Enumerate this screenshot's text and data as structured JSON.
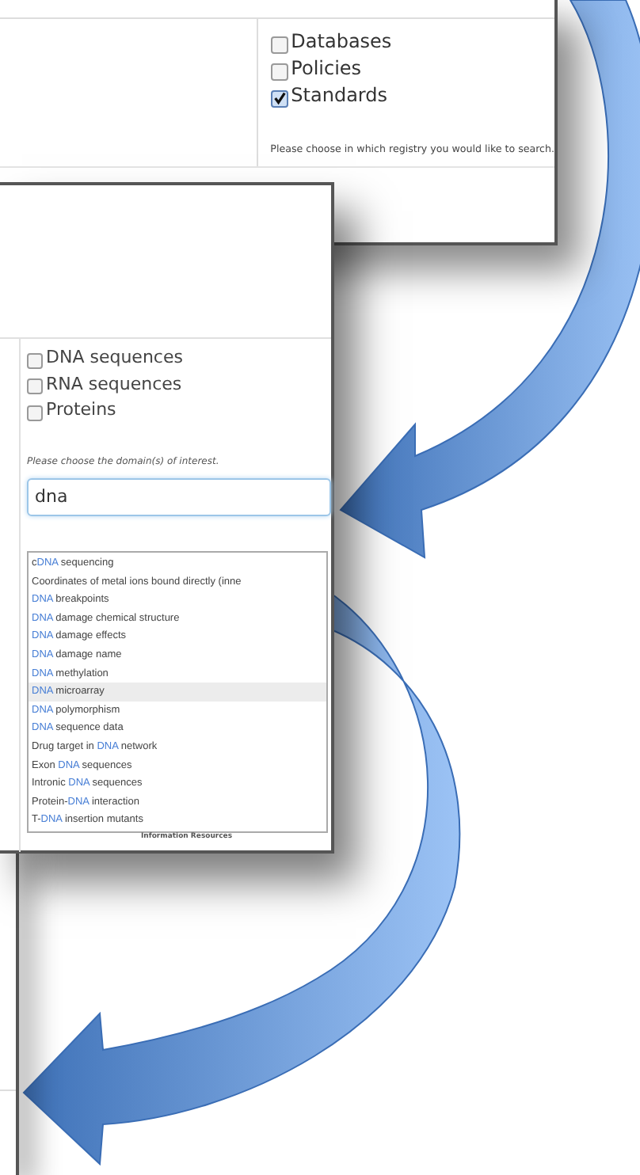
{
  "registry_panel": {
    "options": [
      {
        "label": "Databases",
        "checked": false
      },
      {
        "label": "Policies",
        "checked": false
      },
      {
        "label": "Standards",
        "checked": true
      }
    ],
    "help": "Please choose in which registry you would like to search."
  },
  "domain_panel": {
    "options": [
      {
        "label": "DNA sequences",
        "checked": false
      },
      {
        "label": "RNA sequences",
        "checked": false
      },
      {
        "label": "Proteins",
        "checked": false
      }
    ],
    "help": "Please choose the domain(s) of interest.",
    "search": {
      "value": "dna"
    },
    "suggestions": [
      {
        "pre": "c",
        "match": "DNA",
        "post": " sequencing",
        "selected": false
      },
      {
        "pre": "Coordinates of metal ions bound directly (inne",
        "selected": false
      },
      {
        "match": "DNA",
        "post": " breakpoints",
        "selected": false
      },
      {
        "match": "DNA",
        "post": " damage chemical structure",
        "selected": false
      },
      {
        "match": "DNA",
        "post": " damage effects",
        "selected": false
      },
      {
        "match": "DNA",
        "post": " damage name",
        "selected": false
      },
      {
        "match": "DNA",
        "post": " methylation",
        "selected": false
      },
      {
        "match": "DNA",
        "post": " microarray",
        "selected": true
      },
      {
        "match": "DNA",
        "post": " polymorphism",
        "selected": false
      },
      {
        "match": "DNA",
        "post": " sequence data",
        "selected": false
      },
      {
        "pre": "Drug target in ",
        "match": "DNA",
        "post": " network",
        "selected": false
      },
      {
        "pre": "Exon ",
        "match": "DNA",
        "post": " sequences",
        "selected": false
      },
      {
        "pre": "Intronic ",
        "match": "DNA",
        "post": " sequences",
        "selected": false
      },
      {
        "pre": "Protein-",
        "match": "DNA",
        "post": " interaction",
        "selected": false
      },
      {
        "pre": "T-",
        "match": "DNA",
        "post": " insertion mutants",
        "selected": false
      }
    ],
    "footer": "Information Resources"
  }
}
